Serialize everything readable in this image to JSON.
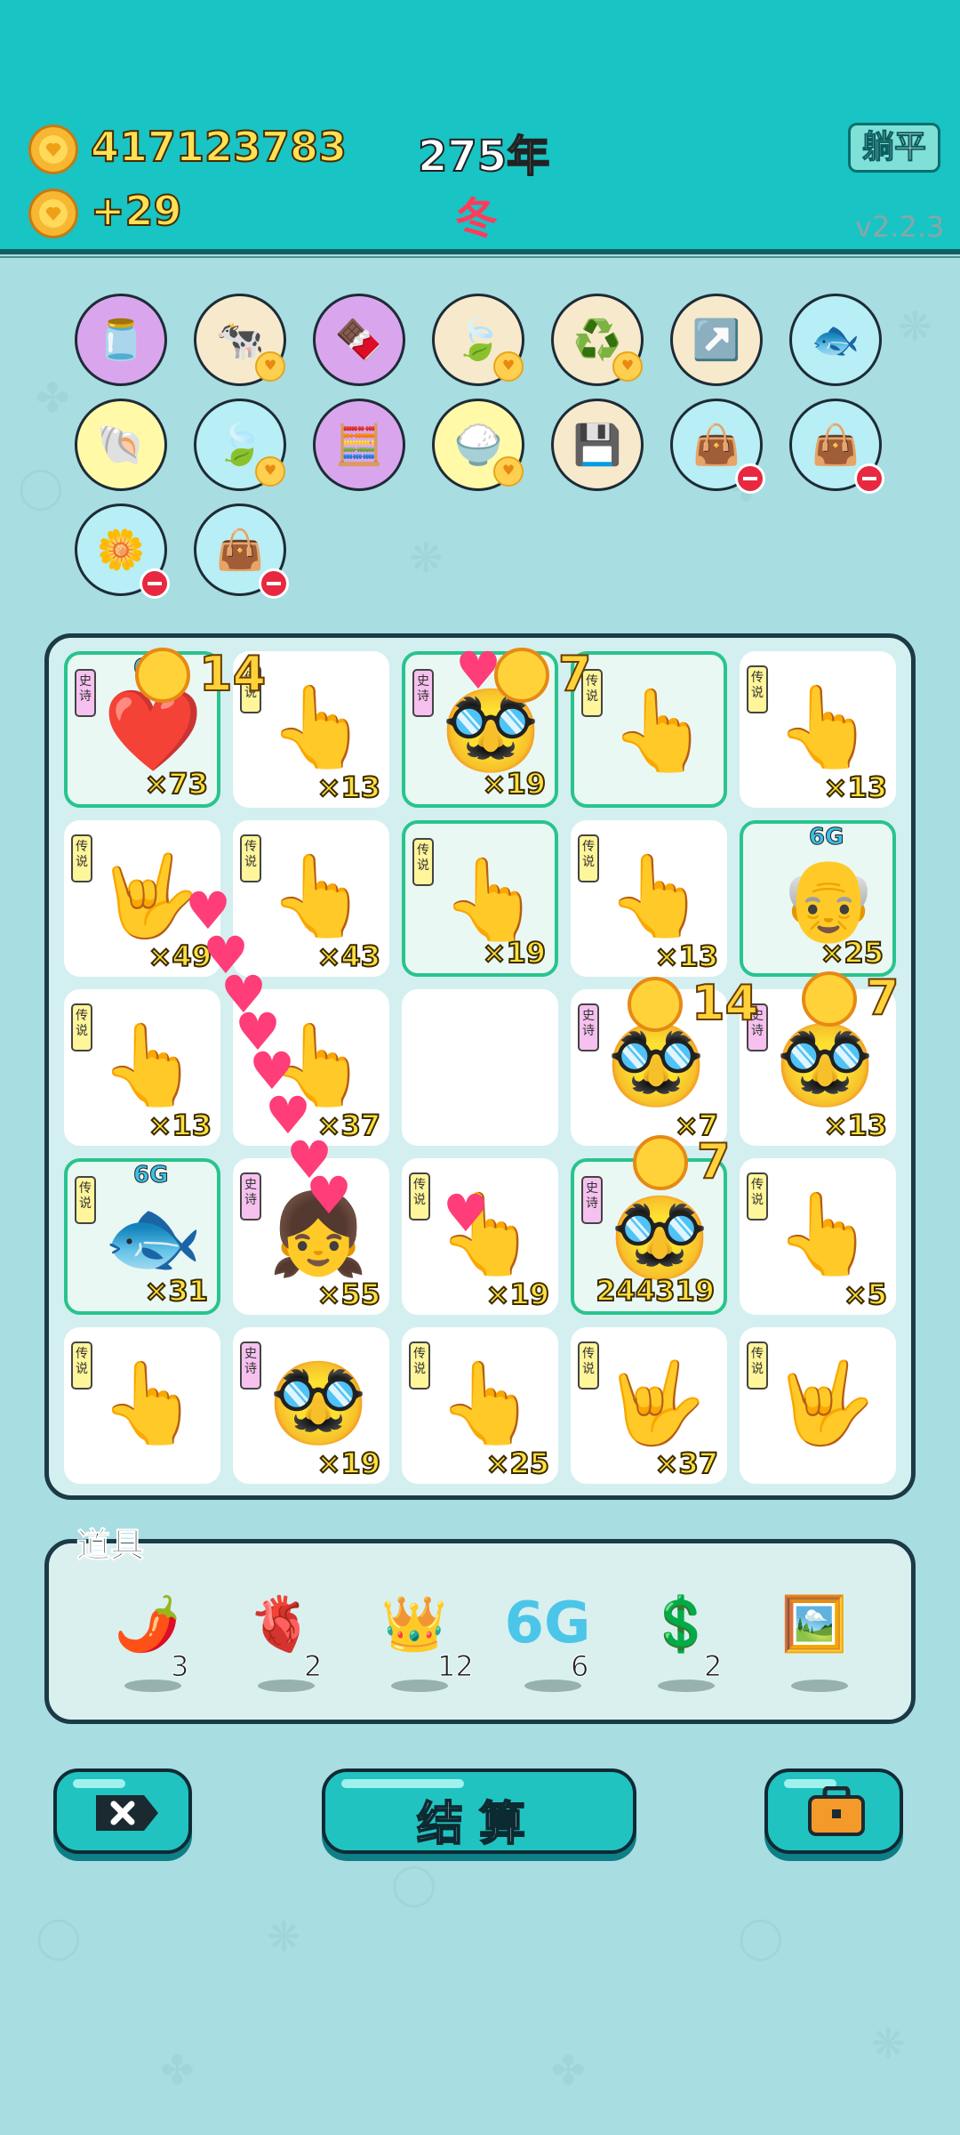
{
  "header": {
    "coins_total": "417123783",
    "coins_income": "+29",
    "year": "275年",
    "season": "冬",
    "lie_flat_label": "躺平",
    "version": "v2.2.3"
  },
  "collection_items": [
    {
      "icon": "milk-jar-icon",
      "color": "#d9a6ee",
      "emoji": "🫙",
      "badge": "none"
    },
    {
      "icon": "cow-couple-icon",
      "color": "#f7e9cc",
      "emoji": "🐄",
      "badge": "heart"
    },
    {
      "icon": "cassette-chocolate-icon",
      "color": "#d9a6ee",
      "emoji": "🍫",
      "badge": "none"
    },
    {
      "icon": "leaf-icon",
      "color": "#f7e9cc",
      "emoji": "🍃",
      "badge": "heart"
    },
    {
      "icon": "recycle-icon",
      "color": "#f7e9cc",
      "emoji": "♻️",
      "badge": "heart"
    },
    {
      "icon": "arrow-box-icon",
      "color": "#f7e9cc",
      "emoji": "↗️",
      "badge": "none"
    },
    {
      "icon": "fish-bowl-icon",
      "color": "#b8eef5",
      "emoji": "🐟",
      "badge": "none"
    },
    {
      "icon": "shell-icon",
      "color": "#fff9a8",
      "emoji": "🐚",
      "badge": "none"
    },
    {
      "icon": "green-leaf-icon",
      "color": "#b8eef5",
      "emoji": "🍃",
      "badge": "heart"
    },
    {
      "icon": "math-head-icon",
      "color": "#d9a6ee",
      "emoji": "🧮",
      "badge": "none"
    },
    {
      "icon": "rice-bowl-icon",
      "color": "#fff9a8",
      "emoji": "🍚",
      "badge": "heart"
    },
    {
      "icon": "chip-icon",
      "color": "#f7e9cc",
      "emoji": "💾",
      "badge": "none"
    },
    {
      "icon": "sack-icon",
      "color": "#b8eef5",
      "emoji": "👜",
      "badge": "minus"
    },
    {
      "icon": "sack-icon",
      "color": "#b8eef5",
      "emoji": "👜",
      "badge": "minus"
    },
    {
      "icon": "flower-pot-icon",
      "color": "#b8eef5",
      "emoji": "🌼",
      "badge": "minus"
    },
    {
      "icon": "sack-icon",
      "color": "#b8eef5",
      "emoji": "👜",
      "badge": "minus"
    }
  ],
  "board": {
    "cells": [
      {
        "tag": "史诗",
        "kind": "heart",
        "count": "×73",
        "gold": true,
        "badge": "6"
      },
      {
        "tag": "传说",
        "kind": "point",
        "count": "×13",
        "gold": false
      },
      {
        "tag": "史诗",
        "kind": "face",
        "count": "×19",
        "gold": true
      },
      {
        "tag": "传说",
        "kind": "point",
        "count": "",
        "gold": true
      },
      {
        "tag": "传说",
        "kind": "point",
        "count": "×13",
        "gold": false
      },
      {
        "tag": "传说",
        "kind": "rock",
        "count": "×49",
        "gold": false
      },
      {
        "tag": "传说",
        "kind": "point",
        "count": "×43",
        "gold": false
      },
      {
        "tag": "传说",
        "kind": "point",
        "count": "×19",
        "gold": true
      },
      {
        "tag": "传说",
        "kind": "point",
        "count": "×13",
        "gold": false
      },
      {
        "tag": "",
        "kind": "oldman",
        "count": "×25",
        "gold": true,
        "badge": "6G"
      },
      {
        "tag": "传说",
        "kind": "point",
        "count": "×13",
        "gold": false
      },
      {
        "tag": "",
        "kind": "point",
        "count": "×37",
        "gold": false
      },
      {
        "tag": "",
        "kind": "empty",
        "count": "",
        "gold": false
      },
      {
        "tag": "史诗",
        "kind": "face",
        "count": "×7",
        "gold": false
      },
      {
        "tag": "史诗",
        "kind": "face",
        "count": "×13",
        "gold": false
      },
      {
        "tag": "传说",
        "kind": "fish",
        "count": "×31",
        "gold": true,
        "badge": "6G"
      },
      {
        "tag": "史诗",
        "kind": "girl",
        "count": "×55",
        "gold": false
      },
      {
        "tag": "传说",
        "kind": "point",
        "count": "×19",
        "gold": false
      },
      {
        "tag": "史诗",
        "kind": "face",
        "count": "244319",
        "gold": true
      },
      {
        "tag": "传说",
        "kind": "point",
        "count": "×5",
        "gold": false
      },
      {
        "tag": "传说",
        "kind": "point",
        "count": "",
        "gold": false
      },
      {
        "tag": "史诗",
        "kind": "face",
        "count": "×19",
        "gold": false
      },
      {
        "tag": "传说",
        "kind": "point",
        "count": "×25",
        "gold": false
      },
      {
        "tag": "传说",
        "kind": "rock",
        "count": "×37",
        "gold": false
      },
      {
        "tag": "传说",
        "kind": "rock",
        "count": "",
        "gold": false
      }
    ],
    "floating_rewards": [
      {
        "value": "14"
      },
      {
        "value": "7"
      },
      {
        "value": "14"
      },
      {
        "value": "7"
      },
      {
        "value": "7"
      }
    ]
  },
  "tools": {
    "title": "道具",
    "items": [
      {
        "icon": "chili-pepper-icon",
        "emoji": "🌶️",
        "count": "3"
      },
      {
        "icon": "liver-icon",
        "emoji": "🫀",
        "count": "2"
      },
      {
        "icon": "crown-icon",
        "emoji": "👑",
        "count": "12"
      },
      {
        "icon": "6g-icon",
        "emoji": "6G",
        "count": "6"
      },
      {
        "icon": "dollar-coin-icon",
        "emoji": "💲",
        "count": "2"
      },
      {
        "icon": "portrait-frame-icon",
        "emoji": "🖼️",
        "count": ""
      }
    ]
  },
  "buttons": {
    "settle_label": "结算"
  }
}
